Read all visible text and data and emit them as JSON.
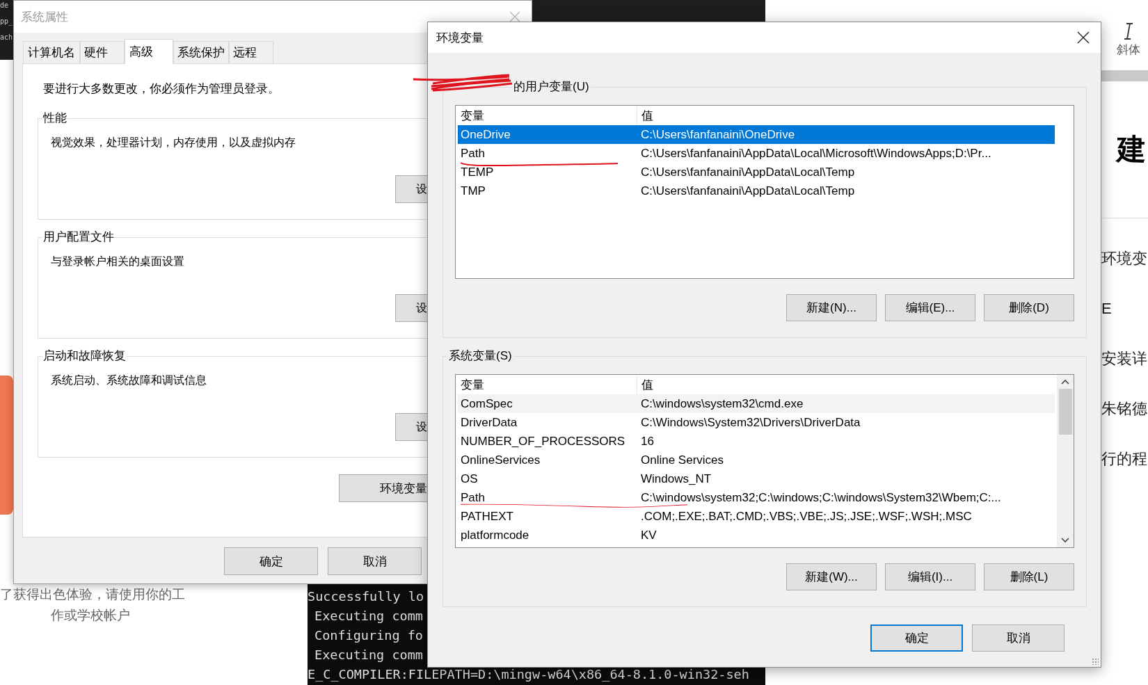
{
  "background": {
    "terminal_fragments": [
      "de",
      "pp_",
      "ach"
    ],
    "terminal_lines": [
      "Successfully lo",
      "Executing comm",
      "Configuring fo",
      "Executing comm",
      "E_C_COMPILER:FILEPATH=D:\\mingw-w64\\x86_64-8.1.0-win32-seh"
    ],
    "page_left_text": [
      "了获得出色体验，请使用你的工",
      "作或学校帐户"
    ],
    "toolbar_item": {
      "label": "斜体"
    },
    "page_right": {
      "heading": "建",
      "lines": [
        "环境变",
        "E",
        "安装详",
        "朱铭德",
        "行的程"
      ]
    }
  },
  "system_properties": {
    "title": "系统属性",
    "tabs": [
      {
        "label": "计算机名",
        "selected": false
      },
      {
        "label": "硬件",
        "selected": false
      },
      {
        "label": "高级",
        "selected": true
      },
      {
        "label": "系统保护",
        "selected": false
      },
      {
        "label": "远程",
        "selected": false
      }
    ],
    "notice": "要进行大多数更改，你必须作为管理员登录。",
    "groups": [
      {
        "title": "性能",
        "description": "视觉效果，处理器计划，内存使用，以及虚拟内存",
        "button": "设"
      },
      {
        "title": "用户配置文件",
        "description": "与登录帐户相关的桌面设置",
        "button": "设"
      },
      {
        "title": "启动和故障恢复",
        "description": "系统启动、系统故障和调试信息",
        "button": "设"
      }
    ],
    "env_button": "环境变量",
    "buttons": [
      "确定",
      "取消"
    ]
  },
  "env_dialog": {
    "title": "环境变量",
    "user_vars": {
      "label": "的用户变量(U)",
      "columns": [
        "变量",
        "值"
      ],
      "rows": [
        {
          "name": "OneDrive",
          "value": "C:\\Users\\fanfanaini\\OneDrive",
          "selected": true,
          "hovered": false
        },
        {
          "name": "Path",
          "value": "C:\\Users\\fanfanaini\\AppData\\Local\\Microsoft\\WindowsApps;D:\\Pr...",
          "selected": false,
          "hovered": false
        },
        {
          "name": "TEMP",
          "value": "C:\\Users\\fanfanaini\\AppData\\Local\\Temp",
          "selected": false,
          "hovered": false
        },
        {
          "name": "TMP",
          "value": "C:\\Users\\fanfanaini\\AppData\\Local\\Temp",
          "selected": false,
          "hovered": false
        }
      ],
      "scrollbar": false,
      "buttons": [
        "新建(N)...",
        "编辑(E)...",
        "删除(D)"
      ]
    },
    "system_vars": {
      "label": "系统变量(S)",
      "columns": [
        "变量",
        "值"
      ],
      "rows": [
        {
          "name": "ComSpec",
          "value": "C:\\windows\\system32\\cmd.exe",
          "selected": false,
          "hovered": true
        },
        {
          "name": "DriverData",
          "value": "C:\\Windows\\System32\\Drivers\\DriverData",
          "selected": false,
          "hovered": false
        },
        {
          "name": "NUMBER_OF_PROCESSORS",
          "value": "16",
          "selected": false,
          "hovered": false
        },
        {
          "name": "OnlineServices",
          "value": "Online Services",
          "selected": false,
          "hovered": false
        },
        {
          "name": "OS",
          "value": "Windows_NT",
          "selected": false,
          "hovered": false
        },
        {
          "name": "Path",
          "value": "C:\\windows\\system32;C:\\windows;C:\\windows\\System32\\Wbem;C:...",
          "selected": false,
          "hovered": false
        },
        {
          "name": "PATHEXT",
          "value": ".COM;.EXE;.BAT;.CMD;.VBS;.VBE;.JS;.JSE;.WSF;.WSH;.MSC",
          "selected": false,
          "hovered": false
        },
        {
          "name": "platformcode",
          "value": "KV",
          "selected": false,
          "hovered": false
        }
      ],
      "scrollbar": true,
      "buttons": [
        "新建(W)...",
        "编辑(I)...",
        "删除(L)"
      ]
    },
    "buttons": [
      {
        "label": "确定",
        "default": true
      },
      {
        "label": "取消",
        "default": false
      }
    ]
  }
}
